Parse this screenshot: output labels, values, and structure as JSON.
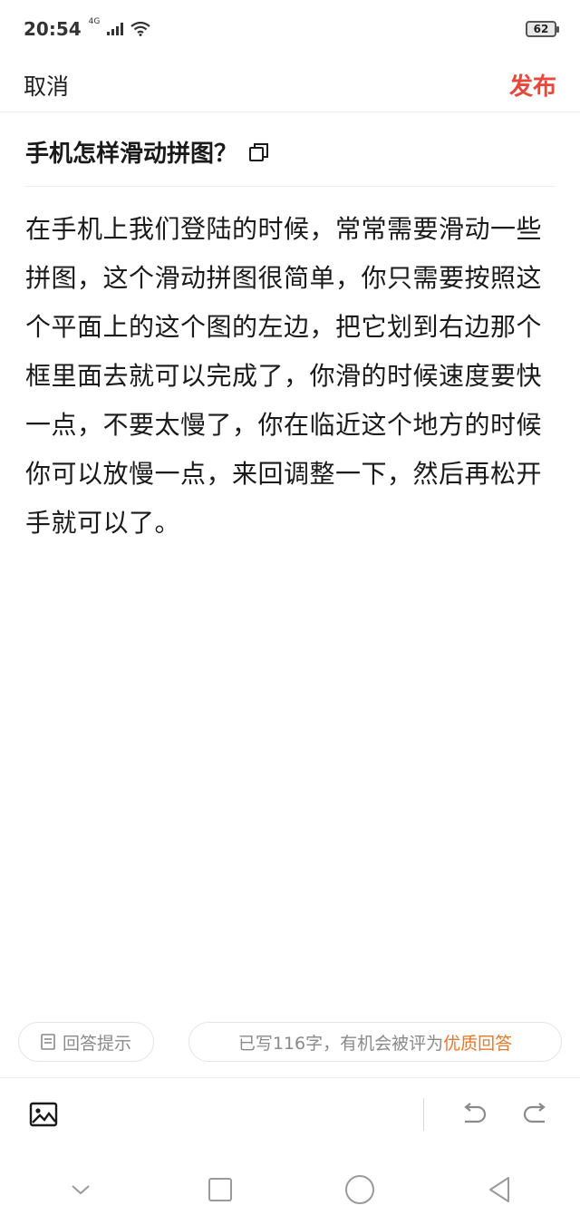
{
  "status_bar": {
    "time": "20:54",
    "network": "4G",
    "battery": "62"
  },
  "nav": {
    "cancel_label": "取消",
    "publish_label": "发布"
  },
  "question": {
    "title": "手机怎样滑动拼图？"
  },
  "answer": {
    "text": "在手机上我们登陆的时候，常常需要滑动一些拼图，这个滑动拼图很简单，你只需要按照这个平面上的这个图的左边，把它划到右边那个框里面去就可以完成了，你滑的时候速度要快一点，不要太慢了，你在临近这个地方的时候你可以放慢一点，来回调整一下，然后再松开手就可以了。"
  },
  "hints": {
    "tips_label": "回答提示",
    "count_prefix": "已写116字，有机会被评为",
    "quality_label": "优质回答"
  },
  "colors": {
    "publish": "#e8473c",
    "quality": "#e07a2e"
  },
  "icons": {
    "copy": "copy-icon",
    "image": "image-icon",
    "undo": "undo-icon",
    "redo": "redo-icon",
    "tips": "document-icon",
    "nav_down": "chevron-down-icon",
    "nav_recent": "square-icon",
    "nav_home": "circle-icon",
    "nav_back": "triangle-back-icon"
  }
}
